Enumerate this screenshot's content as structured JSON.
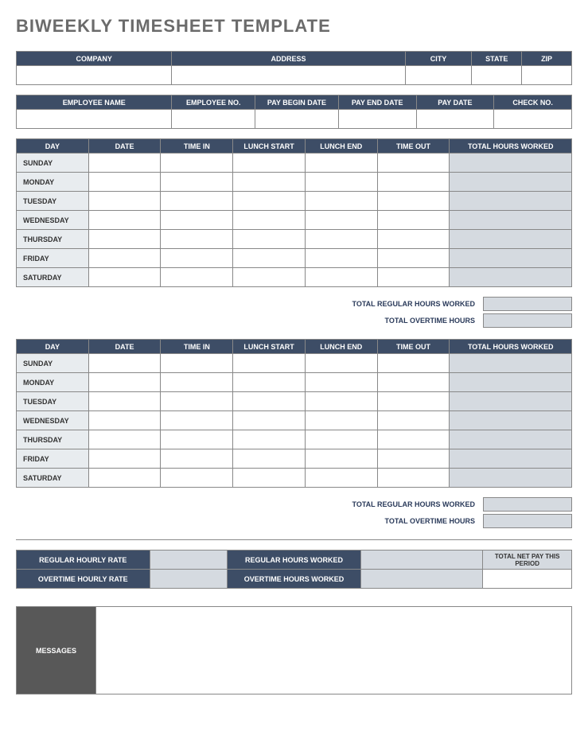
{
  "title": "BIWEEKLY TIMESHEET TEMPLATE",
  "company_headers": {
    "company": "COMPANY",
    "address": "ADDRESS",
    "city": "CITY",
    "state": "STATE",
    "zip": "ZIP"
  },
  "employee_headers": {
    "name": "EMPLOYEE NAME",
    "no": "EMPLOYEE NO.",
    "begin": "PAY BEGIN DATE",
    "end": "PAY END DATE",
    "paydate": "PAY DATE",
    "check": "CHECK NO."
  },
  "week_headers": {
    "day": "DAY",
    "date": "DATE",
    "timein": "TIME IN",
    "lunchstart": "LUNCH START",
    "lunchend": "LUNCH END",
    "timeout": "TIME OUT",
    "total": "TOTAL HOURS WORKED"
  },
  "days": [
    "SUNDAY",
    "MONDAY",
    "TUESDAY",
    "WEDNESDAY",
    "THURSDAY",
    "FRIDAY",
    "SATURDAY"
  ],
  "totals": {
    "regular": "TOTAL REGULAR HOURS WORKED",
    "overtime": "TOTAL OVERTIME HOURS"
  },
  "rates": {
    "reg_rate": "REGULAR HOURLY RATE",
    "reg_hours": "REGULAR HOURS WORKED",
    "ot_rate": "OVERTIME HOURLY RATE",
    "ot_hours": "OVERTIME HOURS WORKED",
    "netpay": "TOTAL NET PAY THIS PERIOD"
  },
  "messages_label": "MESSAGES"
}
